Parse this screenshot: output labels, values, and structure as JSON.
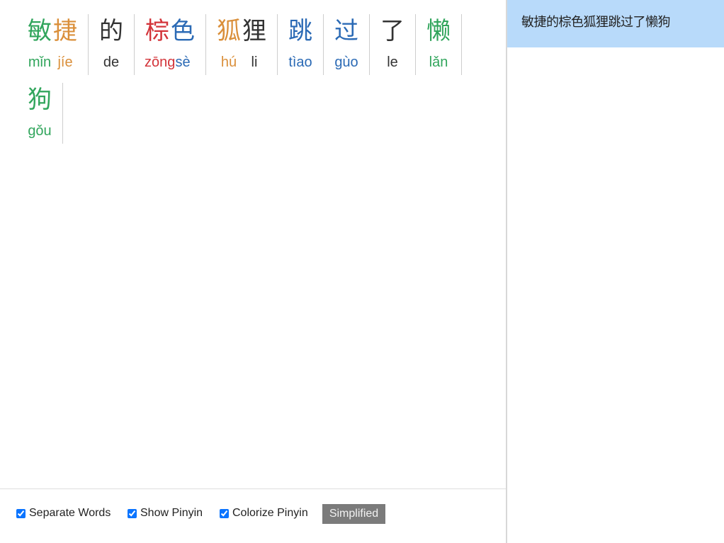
{
  "words": [
    {
      "chars": [
        "敏",
        "捷"
      ],
      "pinyin": [
        "mǐn",
        "jíe"
      ],
      "tones": [
        3,
        2
      ]
    },
    {
      "chars": [
        "的"
      ],
      "pinyin": [
        "de"
      ],
      "tones": [
        5
      ]
    },
    {
      "chars": [
        "棕",
        "色"
      ],
      "pinyin": [
        "zōng",
        "sè"
      ],
      "tones": [
        1,
        4
      ]
    },
    {
      "chars": [
        "狐",
        "狸"
      ],
      "pinyin": [
        "hú",
        "li"
      ],
      "tones": [
        2,
        5
      ]
    },
    {
      "chars": [
        "跳"
      ],
      "pinyin": [
        "tìao"
      ],
      "tones": [
        4
      ]
    },
    {
      "chars": [
        "过"
      ],
      "pinyin": [
        "gùo"
      ],
      "tones": [
        4
      ]
    },
    {
      "chars": [
        "了"
      ],
      "pinyin": [
        "le"
      ],
      "tones": [
        5
      ]
    },
    {
      "chars": [
        "懒"
      ],
      "pinyin": [
        "lǎn"
      ],
      "tones": [
        3
      ]
    },
    {
      "chars": [
        "狗"
      ],
      "pinyin": [
        "gǒu"
      ],
      "tones": [
        3
      ]
    }
  ],
  "tone_colors": {
    "1": "#d3343a",
    "2": "#da8f3a",
    "3": "#31a55c",
    "4": "#2b6ab5",
    "5": "#333333"
  },
  "options": {
    "separate_words": {
      "label": "Separate Words",
      "checked": true
    },
    "show_pinyin": {
      "label": "Show Pinyin",
      "checked": true
    },
    "colorize_pinyin": {
      "label": "Colorize Pinyin",
      "checked": true
    }
  },
  "script_toggle": {
    "label": "Simplified"
  },
  "sidebar": {
    "items": [
      {
        "text": "敏捷的棕色狐狸跳过了懒狗",
        "selected": true
      }
    ]
  },
  "colors": {
    "sidebar_selected_bg": "#b8dafa",
    "button_bg": "#7b7b7b"
  }
}
